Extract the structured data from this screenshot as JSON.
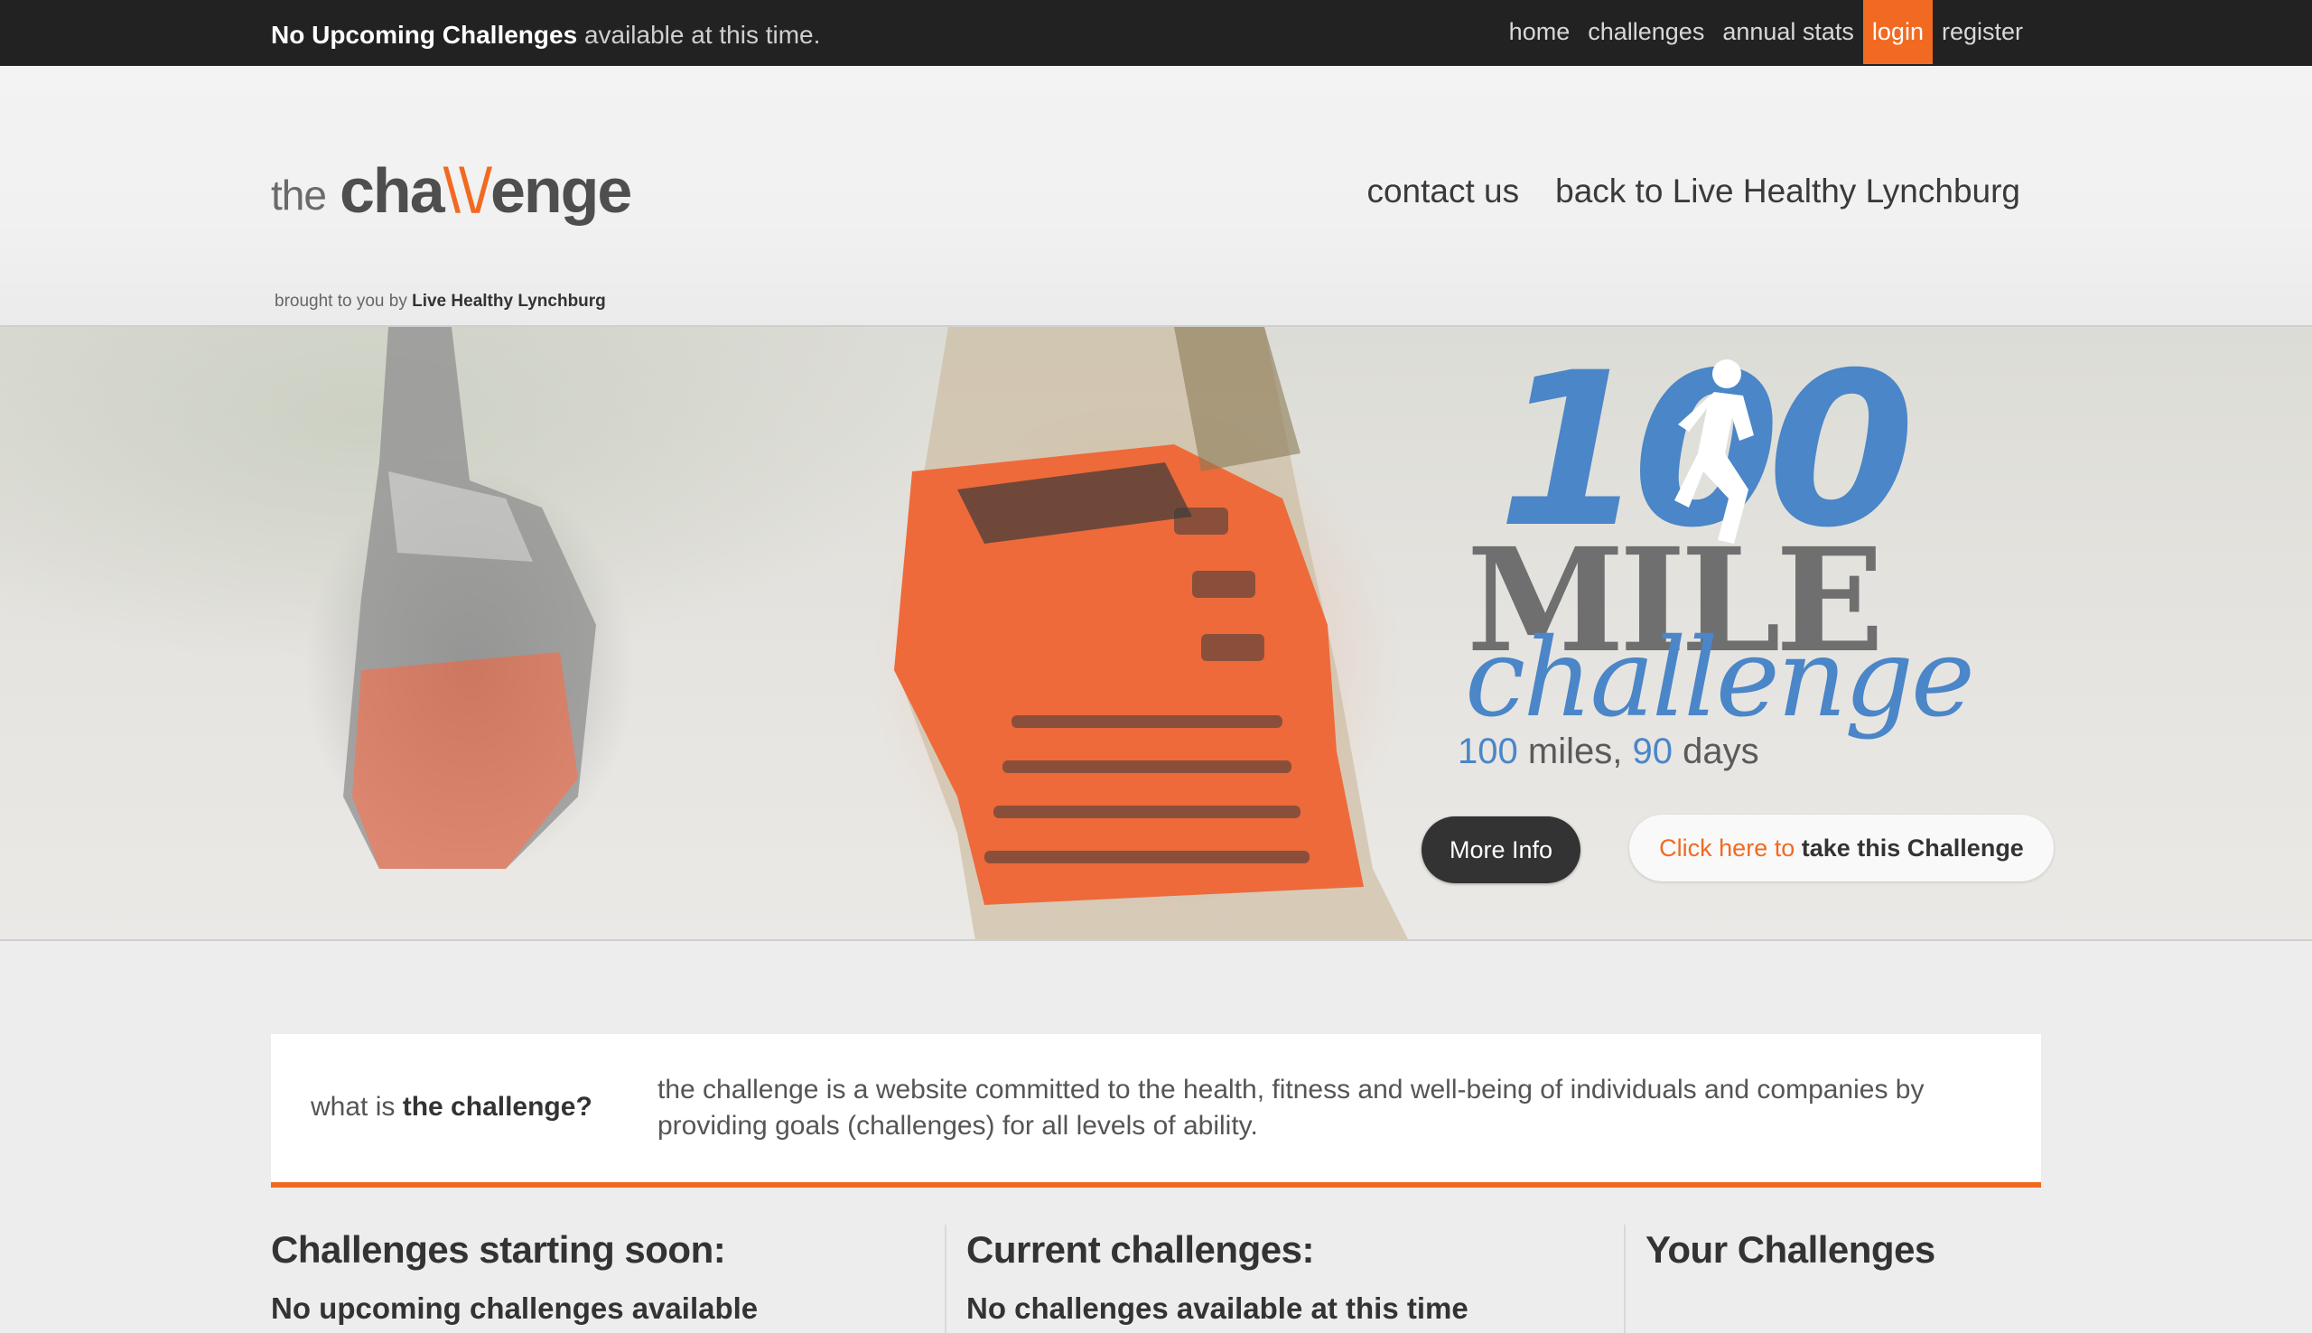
{
  "topbar": {
    "notice_bold": "No Upcoming Challenges",
    "notice_rest": "available at this time.",
    "nav": [
      {
        "label": "home",
        "active": false
      },
      {
        "label": "challenges",
        "active": false
      },
      {
        "label": "annual stats",
        "active": false
      },
      {
        "label": "login",
        "active": true
      },
      {
        "label": "register",
        "active": false
      }
    ]
  },
  "header": {
    "logo": {
      "the": "the",
      "cha": "cha",
      "ll": "\\\\/",
      "enge": "enge",
      "tag_prefix": "brought to you by",
      "tag_bold": "Live Healthy Lynchburg"
    },
    "nav": [
      {
        "label": "contact us"
      },
      {
        "label": "back to Live Healthy Lynchburg"
      }
    ]
  },
  "hero": {
    "badge": {
      "number": "100",
      "mile": "MILE",
      "challenge": "challenge",
      "sub_num1": "100",
      "sub_text1": "miles,",
      "sub_num2": "90",
      "sub_text2": "days"
    },
    "more_info_label": "More Info",
    "take_prefix": "Click here to",
    "take_bold": "take this Challenge"
  },
  "intro": {
    "label_prefix": "what is",
    "label_bold": "the challenge?",
    "text": "the challenge is a website committed to the health, fitness and well-being of individuals and companies by providing goals (challenges) for all levels of ability."
  },
  "columns": {
    "soon_title": "Challenges starting soon:",
    "soon_text": "No upcoming challenges available",
    "current_title": "Current challenges:",
    "current_text": "No challenges available at this time",
    "yours_title": "Your Challenges"
  },
  "colors": {
    "accent": "#f26a21",
    "topbar": "#222222",
    "badge_blue": "#4a86c8"
  }
}
